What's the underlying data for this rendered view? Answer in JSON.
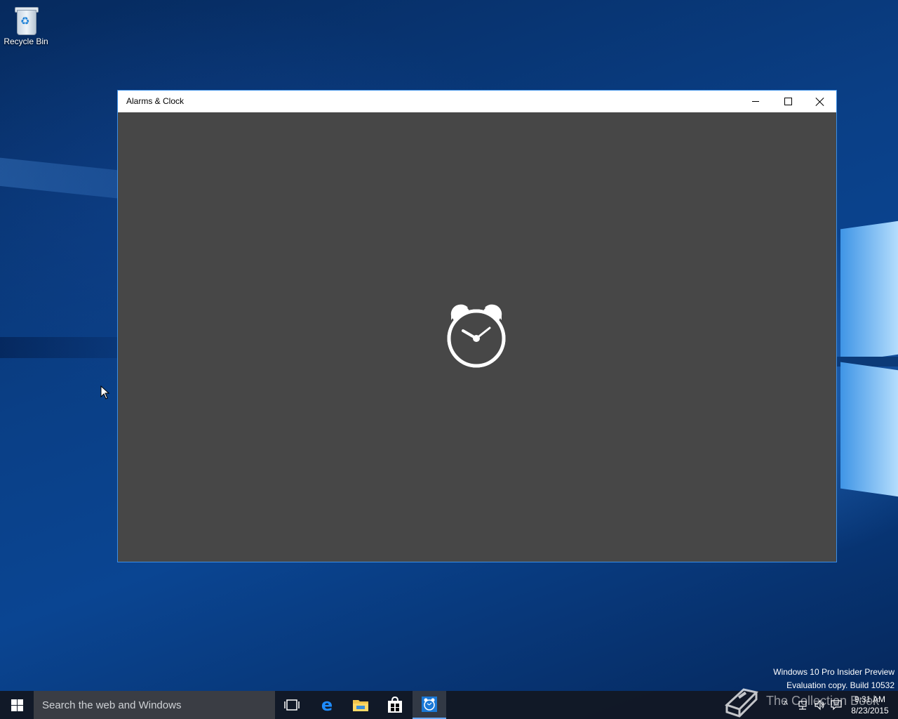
{
  "desktop": {
    "icons": [
      {
        "label": "Recycle Bin"
      }
    ],
    "watermark_line1": "Windows 10 Pro Insider Preview",
    "watermark_line2": "Evaluation copy. Build 10532",
    "overlay_brand": "The Collection Book"
  },
  "window": {
    "title": "Alarms & Clock",
    "content_background": "#474747",
    "splash_icon": "alarm-clock-icon"
  },
  "taskbar": {
    "search_placeholder": "Search the web and Windows",
    "pinned": [
      "task-view-icon",
      "edge-icon",
      "file-explorer-icon",
      "store-icon",
      "alarms-clock-icon"
    ],
    "active_app": "Alarms & Clock",
    "time": "9:31 AM",
    "date": "8/23/2015"
  },
  "colors": {
    "accent": "#3a8ee6",
    "taskbar_active_underline": "#68a9ff"
  }
}
